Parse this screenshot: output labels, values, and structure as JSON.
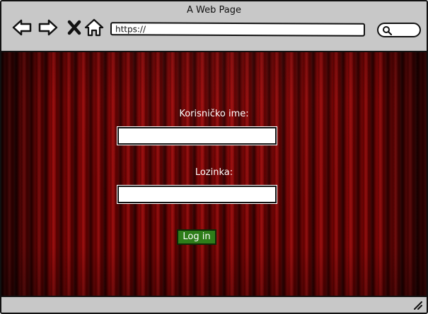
{
  "window": {
    "title": "A Web Page"
  },
  "toolbar": {
    "icons": [
      "back-arrow-icon",
      "forward-arrow-icon",
      "close-icon",
      "home-icon",
      "search-icon"
    ],
    "address": "https://"
  },
  "login": {
    "username_label": "Korisničko ime:",
    "username_value": "",
    "password_label": "Lozinka:",
    "password_value": "",
    "submit_label": "Log in"
  },
  "colors": {
    "curtain": "#6a0000",
    "button": "#2e7d1a",
    "chrome": "#c8c8c8"
  }
}
